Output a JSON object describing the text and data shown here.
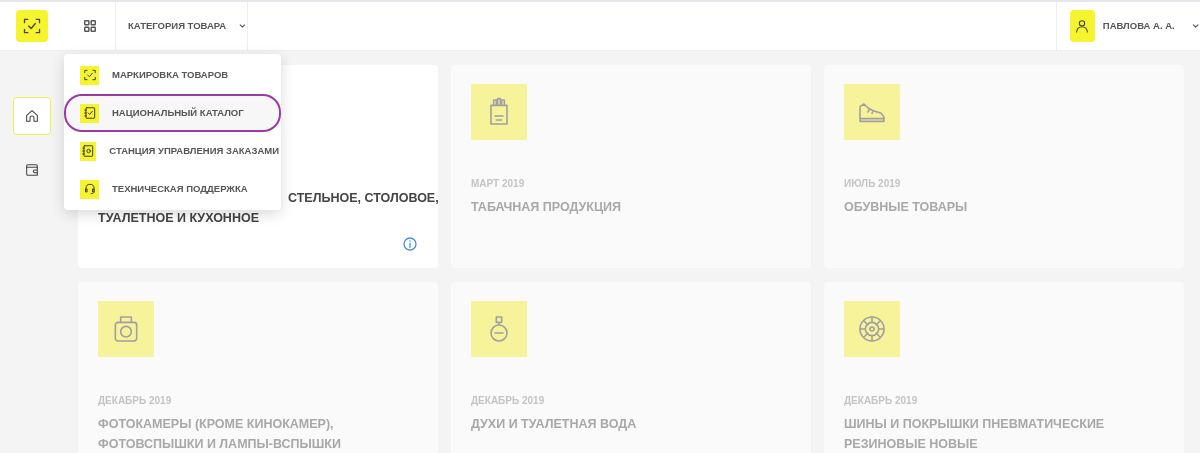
{
  "header": {
    "category_label": "КАТЕГОРИЯ ТОВАРА",
    "user_name": "ПАВЛОВА А. А."
  },
  "sidebar": {
    "items": [
      {
        "kind": "home",
        "selected": true
      },
      {
        "kind": "wallet",
        "selected": false
      }
    ]
  },
  "menu": {
    "items": [
      {
        "kind": "marking",
        "label": "МАРКИРОВКА ТОВАРОВ",
        "highlighted": false
      },
      {
        "kind": "catalog",
        "label": "НАЦИОНАЛЬНЫЙ КАТАЛОГ",
        "highlighted": true
      },
      {
        "kind": "station",
        "label": "СТАНЦИЯ УПРАВЛЕНИЯ ЗАКАЗАМИ",
        "highlighted": false
      },
      {
        "kind": "support",
        "label": "ТЕХНИЧЕСКАЯ ПОДДЕРЖКА",
        "highlighted": false
      }
    ]
  },
  "cards": [
    {
      "kind": "covered",
      "active": true,
      "title_lines": [
        "СТЕЛЬНОЕ, СТОЛОВОЕ,",
        "ТУАЛЕТНОЕ И КУХОННОЕ"
      ],
      "info": true
    },
    {
      "kind": "tobacco",
      "active": false,
      "date": "МАРТ 2019",
      "title": "ТАБАЧНАЯ ПРОДУКЦИЯ"
    },
    {
      "kind": "shoes",
      "active": false,
      "date": "ИЮЛЬ 2019",
      "title": "ОБУВНЫЕ ТОВАРЫ"
    },
    {
      "kind": "camera",
      "active": false,
      "date": "ДЕКАБРЬ 2019",
      "title": "ФОТОКАМЕРЫ (КРОМЕ КИНОКАМЕР), ФОТОВСПЫШКИ И ЛАМПЫ-ВСПЫШКИ"
    },
    {
      "kind": "perfume",
      "active": false,
      "date": "ДЕКАБРЬ 2019",
      "title": "ДУХИ И ТУАЛЕТНАЯ ВОДА"
    },
    {
      "kind": "tire",
      "active": false,
      "date": "ДЕКАБРЬ 2019",
      "title": "ШИНЫ И ПОКРЫШКИ ПНЕВМАТИЧЕСКИЕ РЕЗИНОВЫЕ НОВЫЕ"
    }
  ]
}
